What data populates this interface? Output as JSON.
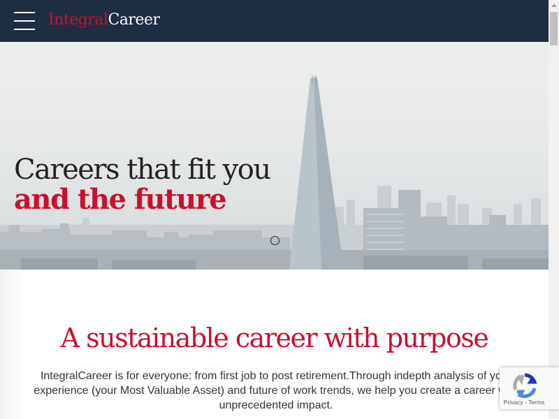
{
  "header": {
    "logo_part1": "Integral",
    "logo_part2": "Career"
  },
  "hero": {
    "line1": "Careers that fit you",
    "line2": "and the future"
  },
  "section": {
    "title": "A sustainable career with purpose",
    "body": "IntegralCareer is for everyone: from first job to post retirement.Through indepth analysis of your experience (your Most Valuable Asset) and future of work trends, we help you create a career with unprecedented impact."
  },
  "recaptcha": {
    "privacy": "Privacy",
    "separator": " - ",
    "terms": "Terms"
  },
  "colors": {
    "header_bg": "#1f2d42",
    "brand_red": "#c8102e"
  }
}
